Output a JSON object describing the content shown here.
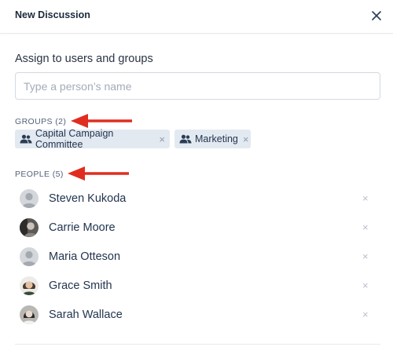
{
  "header": {
    "title": "New Discussion"
  },
  "assign": {
    "title": "Assign to users and groups",
    "placeholder": "Type a person’s name"
  },
  "groups": {
    "heading": "GROUPS (2)",
    "items": [
      {
        "label": "Capital Campaign Committee"
      },
      {
        "label": "Marketing"
      }
    ]
  },
  "people": {
    "heading": "PEOPLE (5)",
    "items": [
      {
        "name": "Steven Kukoda",
        "avatar": "placeholder"
      },
      {
        "name": "Carrie Moore",
        "avatar": "photo"
      },
      {
        "name": "Maria Otteson",
        "avatar": "placeholder"
      },
      {
        "name": "Grace Smith",
        "avatar": "photo"
      },
      {
        "name": "Sarah Wallace",
        "avatar": "photo"
      }
    ]
  },
  "colors": {
    "annotation_arrow": "#e02d20",
    "text": "#22354f",
    "chip_bg": "#e3e9f1"
  }
}
